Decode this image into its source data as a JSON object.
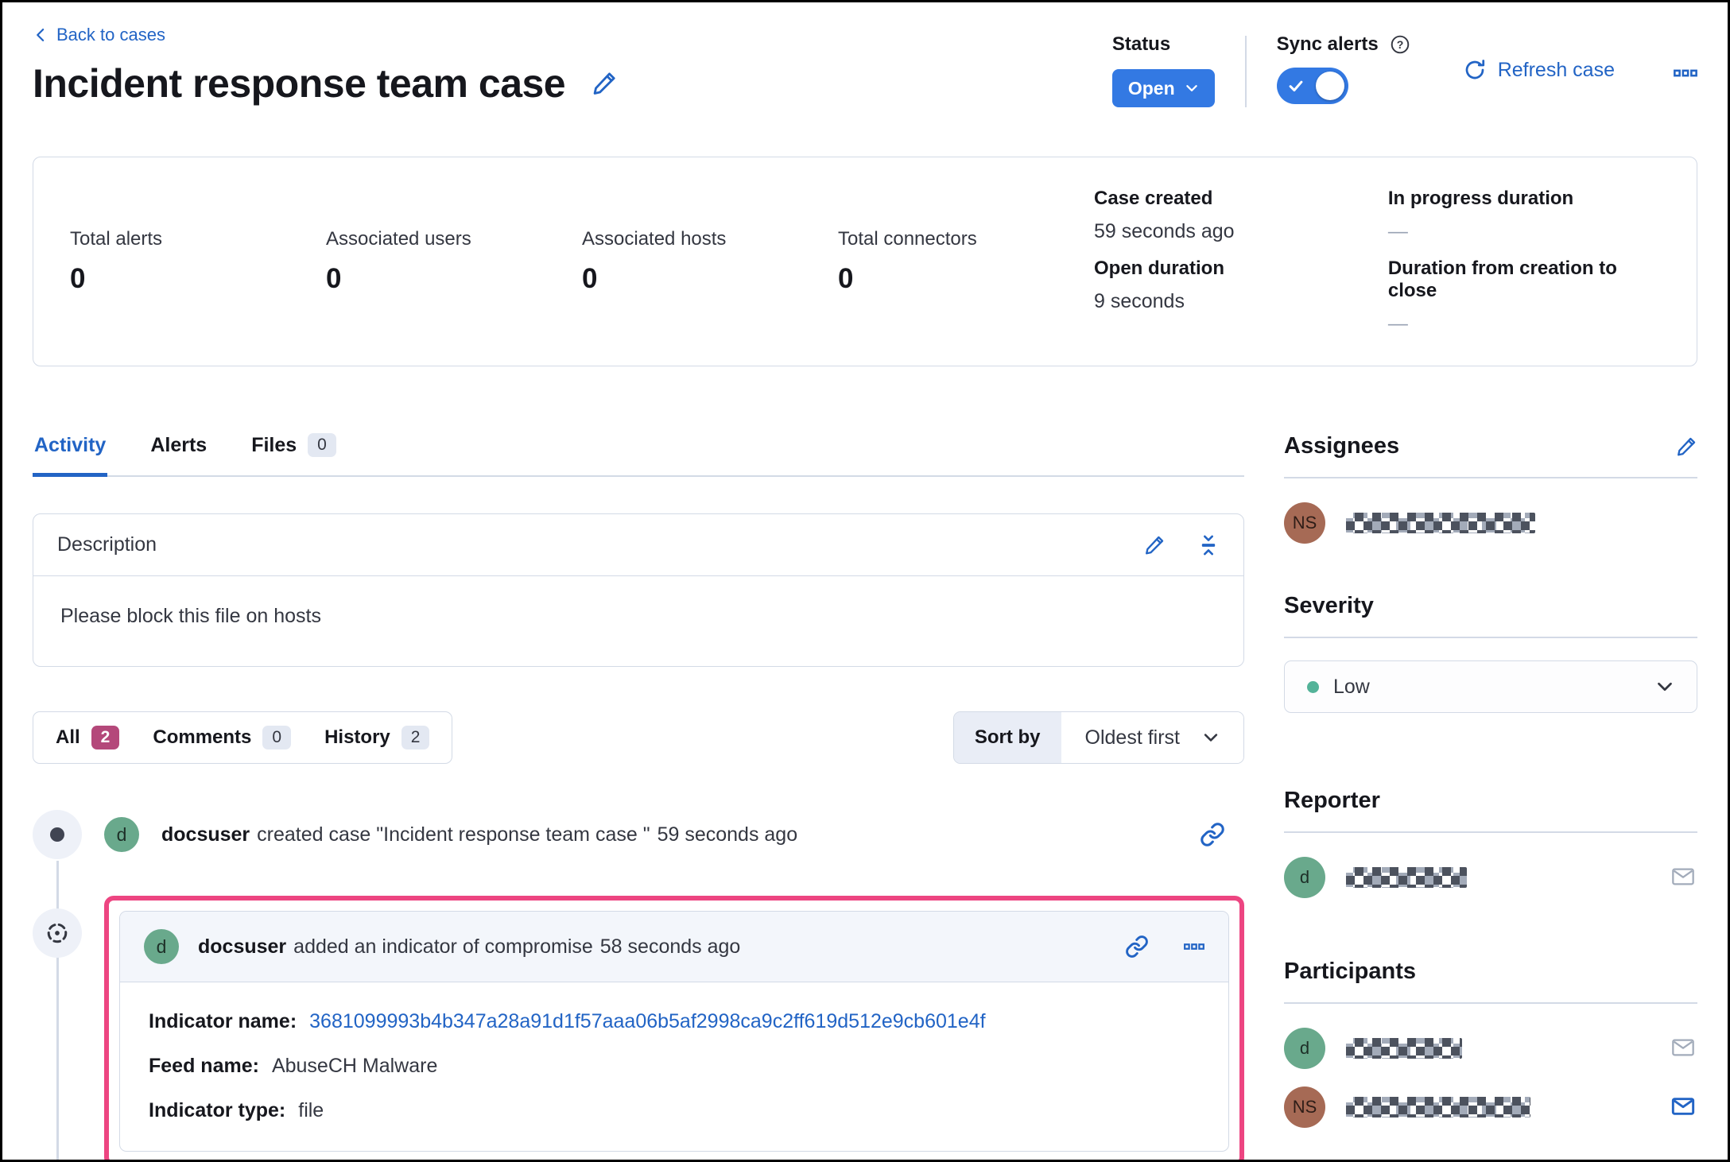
{
  "header": {
    "back_link": "Back to cases",
    "title": "Incident response team case",
    "status": {
      "label": "Status",
      "value": "Open"
    },
    "sync_alerts": {
      "label": "Sync alerts",
      "state": "on"
    },
    "refresh_label": "Refresh case"
  },
  "summary": {
    "metrics": [
      {
        "label": "Total alerts",
        "value": "0"
      },
      {
        "label": "Associated users",
        "value": "0"
      },
      {
        "label": "Associated hosts",
        "value": "0"
      },
      {
        "label": "Total connectors",
        "value": "0"
      }
    ],
    "details": [
      {
        "label": "Case created",
        "value": "59 seconds ago"
      },
      {
        "label": "In progress duration",
        "value": "—"
      },
      {
        "label": "Open duration",
        "value": "9 seconds"
      },
      {
        "label": "Duration from creation to close",
        "value": "—"
      }
    ]
  },
  "tabs": [
    {
      "label": "Activity",
      "active": true
    },
    {
      "label": "Alerts"
    },
    {
      "label": "Files",
      "count": "0"
    }
  ],
  "description": {
    "title": "Description",
    "body": "Please block this file on hosts"
  },
  "filters": {
    "all": {
      "label": "All",
      "count": "2"
    },
    "comments": {
      "label": "Comments",
      "count": "0"
    },
    "history": {
      "label": "History",
      "count": "2"
    },
    "sort": {
      "label": "Sort by",
      "value": "Oldest first"
    }
  },
  "timeline": [
    {
      "avatar": "d",
      "user": "docsuser",
      "action": "created case \"Incident response team case \"",
      "time": "59 seconds ago"
    },
    {
      "avatar": "d",
      "user": "docsuser",
      "action": "added an indicator of compromise",
      "time": "58 seconds ago",
      "fields": [
        {
          "label": "Indicator name:",
          "value": "3681099993b4b347a28a91d1f57aaa06b5af2998ca9c2ff619d512e9cb601e4f",
          "link": true
        },
        {
          "label": "Feed name:",
          "value": "AbuseCH Malware"
        },
        {
          "label": "Indicator type:",
          "value": "file"
        }
      ]
    }
  ],
  "sidebar": {
    "assignees": {
      "title": "Assignees",
      "users": [
        {
          "initials": "NS",
          "name_redacted": true
        }
      ]
    },
    "severity": {
      "title": "Severity",
      "value": "Low",
      "dot_color": "#54b399"
    },
    "reporter": {
      "title": "Reporter",
      "users": [
        {
          "initials": "d",
          "name_redacted": true
        }
      ]
    },
    "participants": {
      "title": "Participants",
      "users": [
        {
          "initials": "d",
          "name_redacted": true
        },
        {
          "initials": "NS",
          "name_redacted": true
        }
      ]
    }
  },
  "colors": {
    "primary_button": "#3379e3",
    "link": "#2264c5",
    "highlight_border": "#ed4581",
    "accent_badge": "#b4487a",
    "severity_dot": "#54b399",
    "avatar_green": "#69a98c",
    "avatar_maroon": "#a66a55",
    "panel_border": "#d3dae6"
  }
}
